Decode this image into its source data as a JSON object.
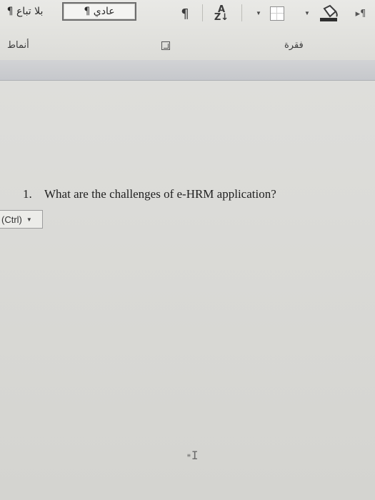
{
  "ribbon": {
    "styles": {
      "no_spacing_label": "¶ بلا تباع",
      "normal_label": "¶ عادي",
      "group_label": "أنماط"
    },
    "paragraph": {
      "group_label": "فقرة",
      "show_marks_glyph": "¶",
      "sort_glyph_top": "A",
      "sort_glyph_bottom": "Z↓",
      "ltr_glyph": "▸¶"
    }
  },
  "document": {
    "list_number": "1.",
    "question_text": "What are the challenges of e-HRM application?",
    "paste_options_label": "(Ctrl)"
  }
}
